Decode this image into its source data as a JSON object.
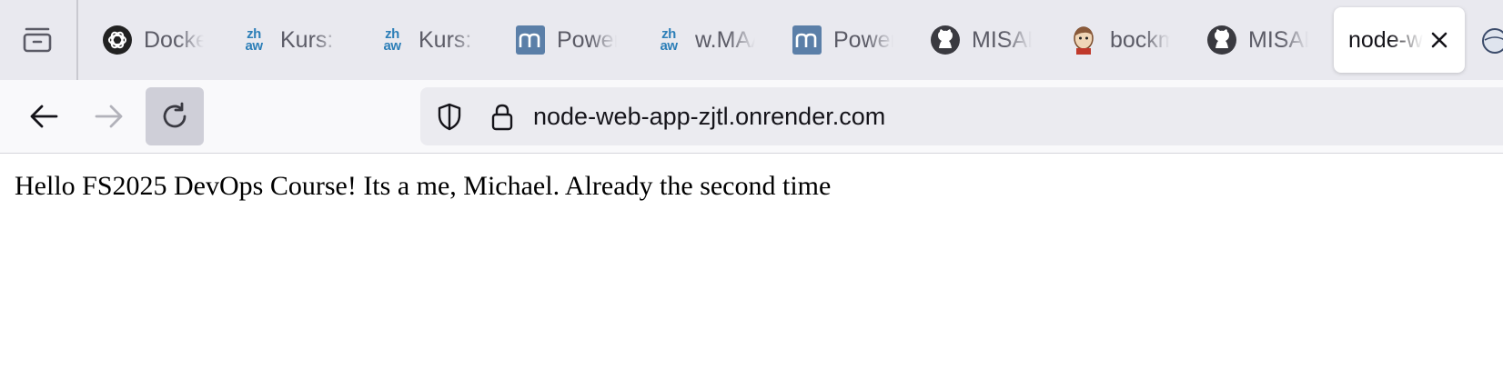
{
  "browser": {
    "tabs": [
      {
        "title": "Docker",
        "icon": "openai-icon"
      },
      {
        "title": "Kurs: DevOps",
        "icon": "zhaw-icon"
      },
      {
        "title": "Kurs: DevOps",
        "icon": "zhaw-icon"
      },
      {
        "title": "PowerPoint",
        "icon": "moodle-icon"
      },
      {
        "title": "w.MAA",
        "icon": "zhaw-icon"
      },
      {
        "title": "PowerPoint",
        "icon": "moodle-icon"
      },
      {
        "title": "MISAB",
        "icon": "github-icon"
      },
      {
        "title": "bockm",
        "icon": "jenkins-icon"
      },
      {
        "title": "MISAB",
        "icon": "github-icon"
      },
      {
        "title": "node-web-app",
        "icon": "",
        "active": true
      }
    ],
    "url": "node-web-app-zjtl.onrender.com",
    "colors": {
      "tabbar": "#e9e9ef",
      "toolbar": "#f9f9fb",
      "urlbar": "#ebebf0",
      "zhaw_blue": "#2d7fb8"
    }
  },
  "page": {
    "message": "Hello FS2025 DevOps Course! Its a me, Michael. Already the second time"
  }
}
